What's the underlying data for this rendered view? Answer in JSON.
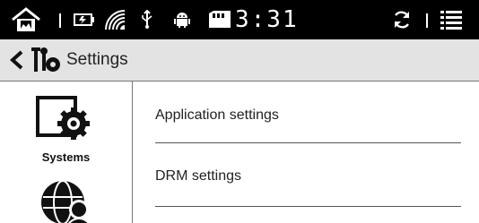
{
  "status_bar": {
    "clock": "3:31",
    "icons": [
      "home-icon",
      "battery-icon",
      "wifi-icon",
      "usb-icon",
      "android-icon",
      "sd-card-icon",
      "refresh-icon",
      "menu-icon"
    ]
  },
  "header": {
    "title": "Settings",
    "icons": [
      "back-icon",
      "settings-tools-icon"
    ]
  },
  "sidebar": {
    "items": [
      {
        "label": "Systems",
        "icon": "system-settings-icon"
      },
      {
        "label": "",
        "icon": "network-users-icon"
      }
    ]
  },
  "main": {
    "items": [
      {
        "label": "Application settings"
      },
      {
        "label": "DRM settings"
      }
    ]
  }
}
